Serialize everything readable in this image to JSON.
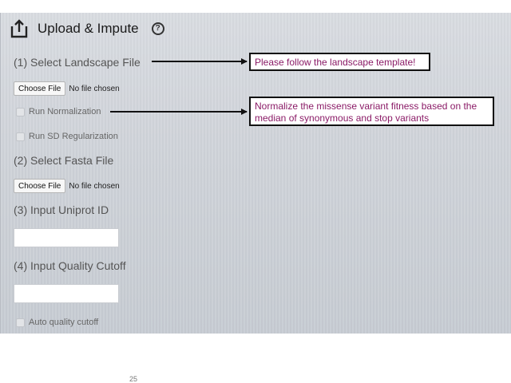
{
  "header": {
    "title": "Upload & Impute",
    "upload_icon": "upload-icon",
    "help_icon": "help-icon",
    "help_glyph": "?"
  },
  "sections": {
    "landscape": {
      "label": "(1) Select Landscape File",
      "button": "Choose File",
      "file_status": "No file chosen"
    },
    "normalization": {
      "label": "Run Normalization"
    },
    "sd_regularization": {
      "label": "Run SD Regularization"
    },
    "fasta": {
      "label": "(2) Select Fasta File",
      "button": "Choose File",
      "file_status": "No file chosen"
    },
    "uniprot": {
      "label": "(3) Input Uniprot ID",
      "value": ""
    },
    "quality": {
      "label": "(4) Input Quality Cutoff",
      "value": ""
    },
    "auto_quality": {
      "label": "Auto quality cutoff"
    }
  },
  "callouts": {
    "landscape_note": "Please follow the landscape template!",
    "normalization_note": "Normalize the missense variant fitness based on the median of synonymous and stop variants"
  },
  "footer": {
    "page_number": "25"
  },
  "colors": {
    "callout_text": "#8a1a66",
    "panel_background": "#d2d6dc"
  }
}
